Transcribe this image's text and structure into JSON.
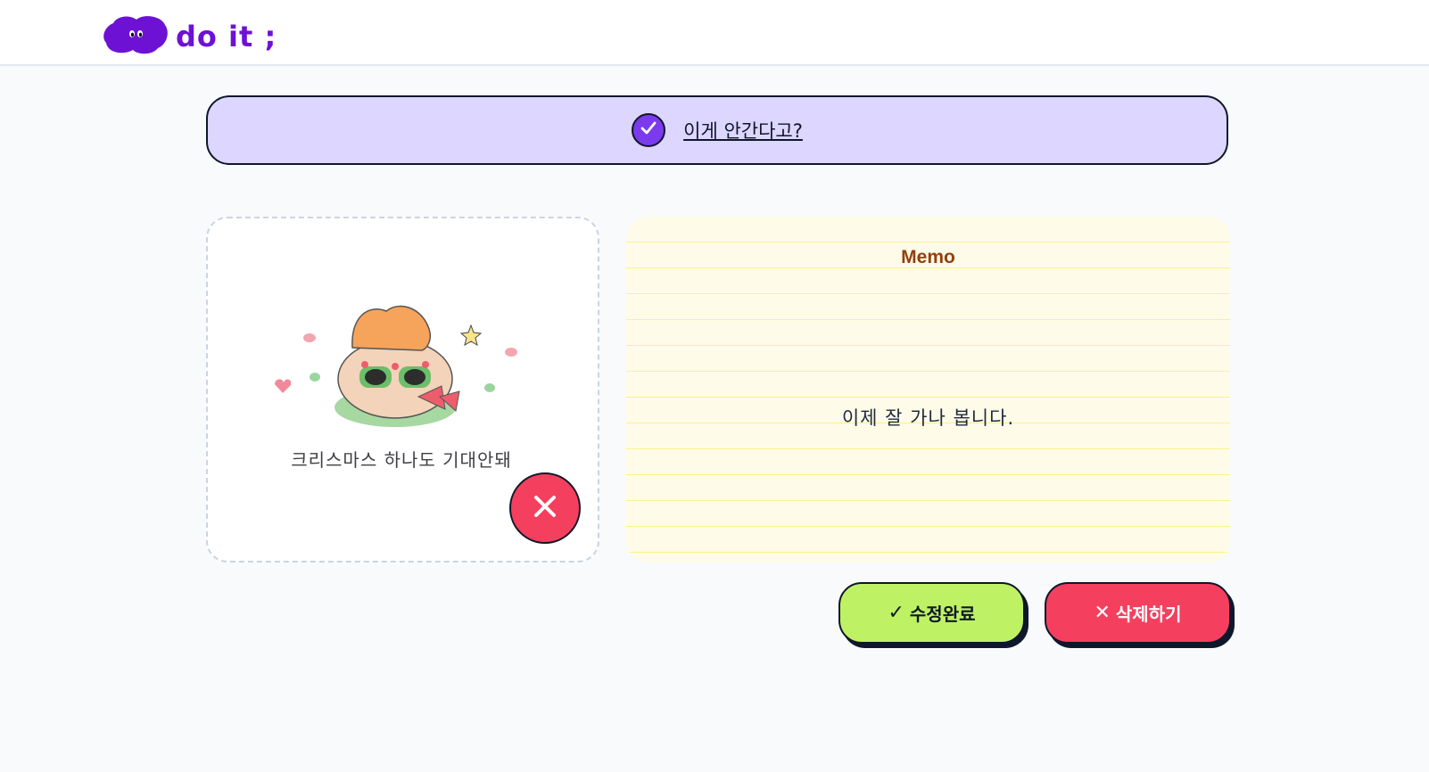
{
  "app": {
    "logo_text": "do it ;"
  },
  "todo": {
    "title": "이게 안간다고?",
    "completed": true
  },
  "image": {
    "caption": "크리스마스 하나도 기대안돼"
  },
  "memo": {
    "title": "Memo",
    "content": "이제 잘 가나 봅니다."
  },
  "actions": {
    "complete_icon": "✓",
    "complete_label": "수정완료",
    "delete_icon": "✕",
    "delete_label": "삭제하기"
  },
  "colors": {
    "brand": "#6d12d4",
    "todo_bg": "#ddd6fe",
    "check": "#7c3aed",
    "complete_btn": "#bef264",
    "delete_btn": "#f43f5e",
    "memo_title": "#92400e"
  }
}
